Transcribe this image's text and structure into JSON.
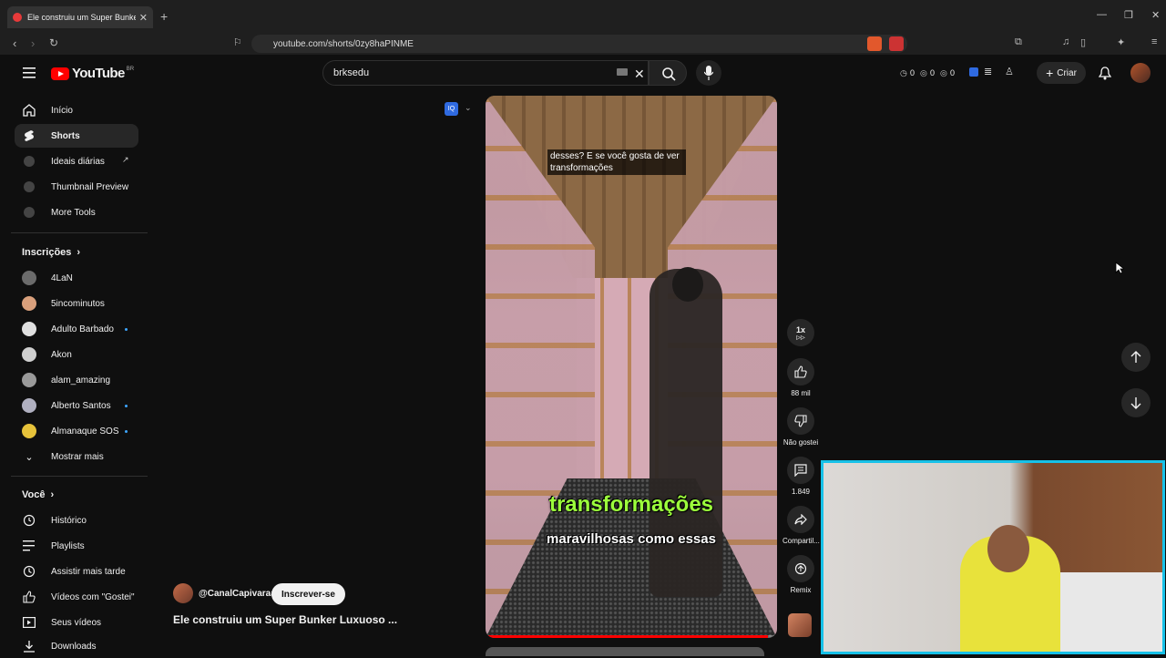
{
  "browser": {
    "tab_title": "Ele construiu um Super Bunker L",
    "url": "youtube.com/shorts/0zy8haPINME"
  },
  "header": {
    "logo_text": "YouTube",
    "logo_country": "BR",
    "search_value": "brksedu",
    "counters": [
      "0",
      "0",
      "0"
    ],
    "create_label": "Criar"
  },
  "sidebar": {
    "main": [
      {
        "label": "Início",
        "icon": "home-icon"
      },
      {
        "label": "Shorts",
        "icon": "shorts-icon"
      },
      {
        "label": "Ideais diárias",
        "icon": "extension-icon"
      },
      {
        "label": "Thumbnail Preview",
        "icon": "extension-icon"
      },
      {
        "label": "More Tools",
        "icon": "extension-icon"
      }
    ],
    "subs_heading": "Inscrições",
    "subscriptions": [
      {
        "label": "4LaN",
        "new": false,
        "color": "#6b6b6b"
      },
      {
        "label": "5incominutos",
        "new": false,
        "color": "#d9a07c"
      },
      {
        "label": "Adulto Barbado",
        "new": true,
        "color": "#e0e0e0"
      },
      {
        "label": "Akon",
        "new": false,
        "color": "#cfcfcf"
      },
      {
        "label": "alam_amazing",
        "new": false,
        "color": "#9a9a9a"
      },
      {
        "label": "Alberto Santos",
        "new": true,
        "color": "#b0b0c0"
      },
      {
        "label": "Almanaque SOS",
        "new": true,
        "color": "#e6c23a"
      }
    ],
    "show_more": "Mostrar mais",
    "you_heading": "Você",
    "you": [
      {
        "label": "Histórico",
        "icon": "history-icon"
      },
      {
        "label": "Playlists",
        "icon": "playlist-icon"
      },
      {
        "label": "Assistir mais tarde",
        "icon": "clock-icon"
      },
      {
        "label": "Vídeos com \"Gostei\"",
        "icon": "thumbs-up-icon"
      },
      {
        "label": "Seus vídeos",
        "icon": "video-icon"
      },
      {
        "label": "Downloads",
        "icon": "download-icon"
      }
    ]
  },
  "video": {
    "caption_top": "desses? E se você gosta de ver transformações",
    "caption_green": "transformações",
    "caption_white": "maravilhosas como essas",
    "progress": 0.97
  },
  "actions": {
    "speed": "1x",
    "likes": "88 mil",
    "dislike": "Não gostei",
    "comments": "1.849",
    "share": "Compartil...",
    "remix": "Remix"
  },
  "meta": {
    "channel": "@CanalCapivaraa",
    "subscribe": "Inscrever-se",
    "title": "Ele construiu um Super Bunker Luxuoso ..."
  },
  "colors": {
    "accent_red": "#ff0000",
    "webcam_border": "#17c1e8",
    "caption_green": "#9cff3c"
  }
}
